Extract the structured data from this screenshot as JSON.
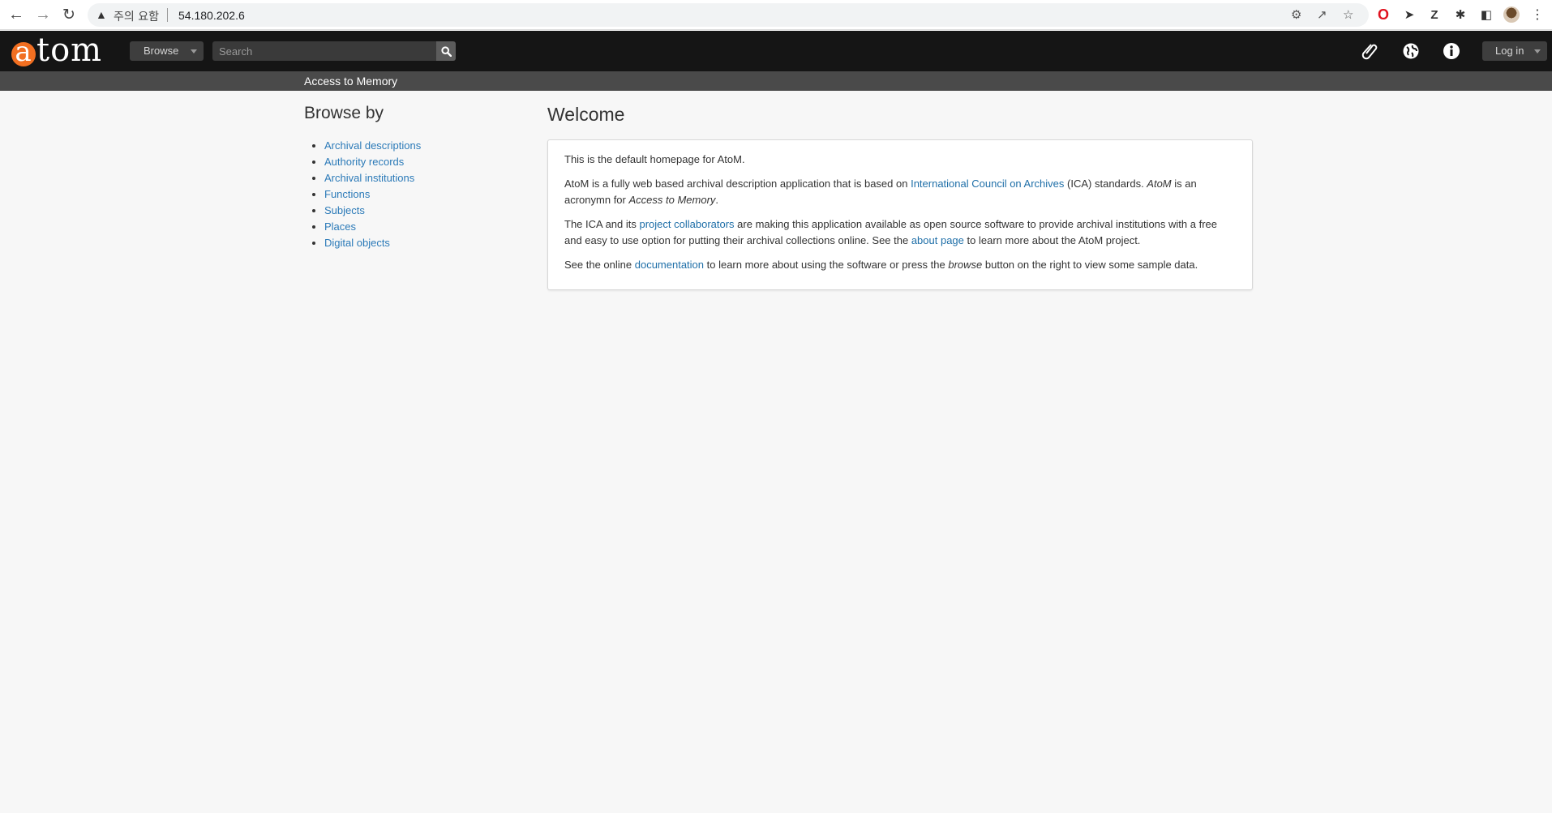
{
  "browser": {
    "security_label": "주의 요함",
    "url": "54.180.202.6"
  },
  "header": {
    "logo_text": "tom",
    "browse_label": "Browse",
    "search_placeholder": "Search",
    "login_label": "Log in",
    "site_name": "Access to Memory"
  },
  "sidebar": {
    "heading": "Browse by",
    "items": [
      "Archival descriptions",
      "Authority records",
      "Archival institutions",
      "Functions",
      "Subjects",
      "Places",
      "Digital objects"
    ]
  },
  "main": {
    "title": "Welcome",
    "p1": "This is the default homepage for AtoM.",
    "p2": {
      "t1": "AtoM is a fully web based archival description application that is based on ",
      "link": "International Council on Archives",
      "t2": " (ICA) standards. ",
      "em1": "AtoM",
      "t3": " is an acronymn for ",
      "em2": "Access to Memory",
      "t4": "."
    },
    "p3": {
      "t1": "The ICA and its ",
      "link1": "project collaborators",
      "t2": " are making this application available as open source software to provide archival institutions with a free and easy to use option for putting their archival collections online. See the ",
      "link2": "about page",
      "t3": " to learn more about the AtoM project."
    },
    "p4": {
      "t1": "See the online ",
      "link": "documentation",
      "t2": " to learn more about using the software or press the ",
      "em": "browse",
      "t3": " button on the right to view some sample data."
    }
  },
  "colors": {
    "brand_orange": "#f26f21",
    "header_bg": "#151515",
    "link": "#2b7ab8"
  }
}
